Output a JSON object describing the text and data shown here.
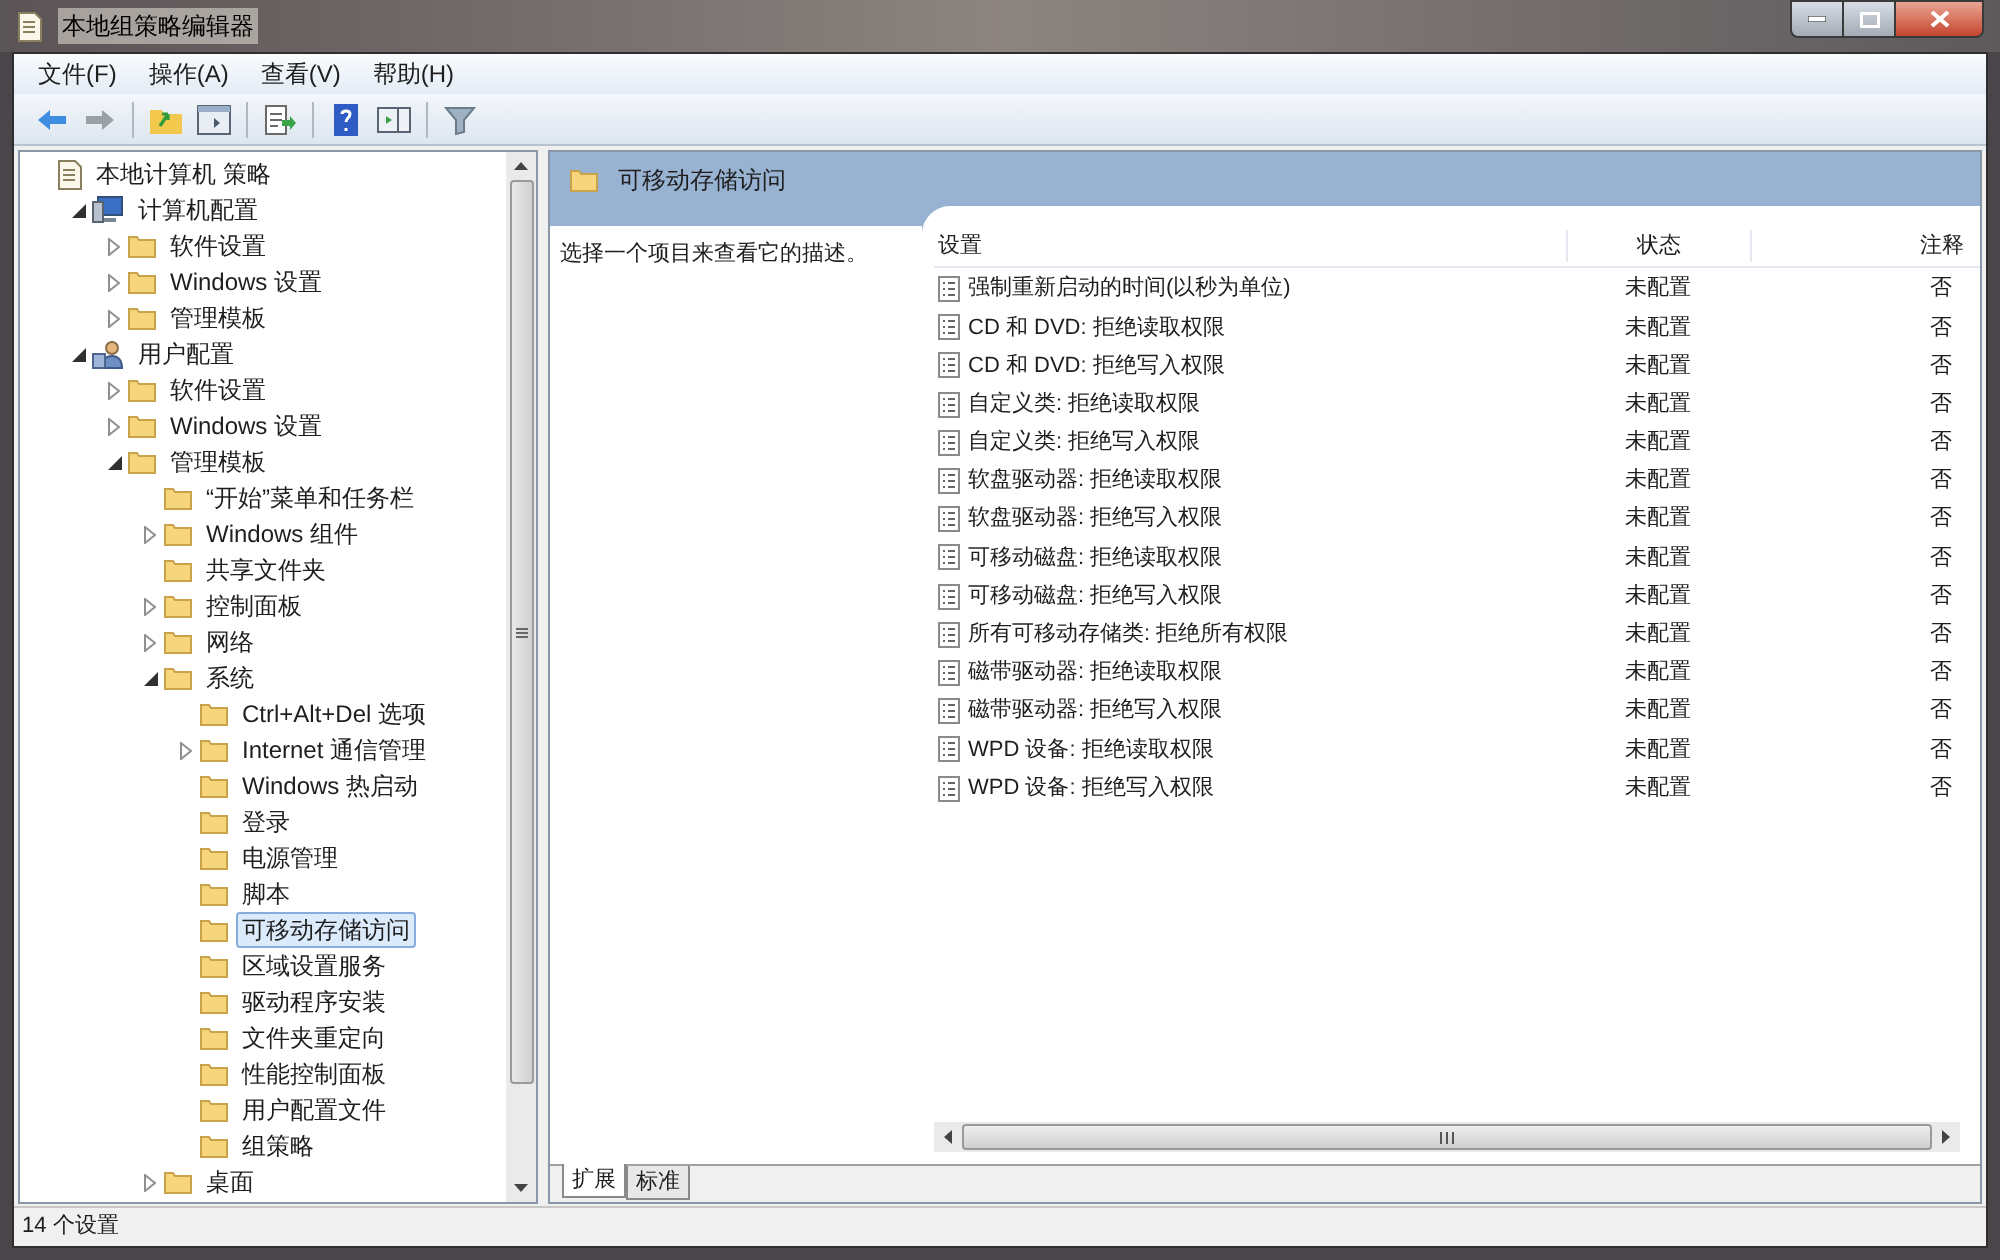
{
  "window": {
    "title": "本地组策略编辑器"
  },
  "menu": [
    "文件(F)",
    "操作(A)",
    "查看(V)",
    "帮助(H)"
  ],
  "tree": [
    {
      "label": "本地计算机 策略",
      "kind": "policy",
      "selected": false,
      "children": [
        {
          "label": "计算机配置",
          "kind": "computer",
          "expanded": true,
          "selected": false,
          "children": [
            {
              "label": "软件设置",
              "kind": "folder",
              "expanded": false,
              "selected": false
            },
            {
              "label": "Windows 设置",
              "kind": "folder",
              "expanded": false,
              "selected": false
            },
            {
              "label": "管理模板",
              "kind": "folder",
              "expanded": false,
              "selected": false
            }
          ]
        },
        {
          "label": "用户配置",
          "kind": "user",
          "expanded": true,
          "selected": false,
          "children": [
            {
              "label": "软件设置",
              "kind": "folder",
              "expanded": false,
              "selected": false
            },
            {
              "label": "Windows 设置",
              "kind": "folder",
              "expanded": false,
              "selected": false
            },
            {
              "label": "管理模板",
              "kind": "folder",
              "expanded": true,
              "selected": false,
              "children": [
                {
                  "label": "“开始”菜单和任务栏",
                  "kind": "folder",
                  "selected": false
                },
                {
                  "label": "Windows 组件",
                  "kind": "folder",
                  "expanded": false,
                  "selected": false
                },
                {
                  "label": "共享文件夹",
                  "kind": "folder",
                  "selected": false
                },
                {
                  "label": "控制面板",
                  "kind": "folder",
                  "expanded": false,
                  "selected": false
                },
                {
                  "label": "网络",
                  "kind": "folder",
                  "expanded": false,
                  "selected": false
                },
                {
                  "label": "系统",
                  "kind": "folder",
                  "expanded": true,
                  "selected": false,
                  "children": [
                    {
                      "label": "Ctrl+Alt+Del 选项",
                      "kind": "folder",
                      "selected": false
                    },
                    {
                      "label": "Internet 通信管理",
                      "kind": "folder",
                      "expanded": false,
                      "selected": false
                    },
                    {
                      "label": "Windows 热启动",
                      "kind": "folder",
                      "selected": false
                    },
                    {
                      "label": "登录",
                      "kind": "folder",
                      "selected": false
                    },
                    {
                      "label": "电源管理",
                      "kind": "folder",
                      "selected": false
                    },
                    {
                      "label": "脚本",
                      "kind": "folder",
                      "selected": false
                    },
                    {
                      "label": "可移动存储访问",
                      "kind": "folder",
                      "selected": true
                    },
                    {
                      "label": "区域设置服务",
                      "kind": "folder",
                      "selected": false
                    },
                    {
                      "label": "驱动程序安装",
                      "kind": "folder",
                      "selected": false
                    },
                    {
                      "label": "文件夹重定向",
                      "kind": "folder",
                      "selected": false
                    },
                    {
                      "label": "性能控制面板",
                      "kind": "folder",
                      "selected": false
                    },
                    {
                      "label": "用户配置文件",
                      "kind": "folder",
                      "selected": false
                    },
                    {
                      "label": "组策略",
                      "kind": "folder",
                      "selected": false
                    }
                  ]
                },
                {
                  "label": "桌面",
                  "kind": "folder",
                  "expanded": false,
                  "selected": false
                }
              ]
            }
          ]
        }
      ]
    }
  ],
  "content": {
    "title": "可移动存储访问",
    "description": "选择一个项目来查看它的描述。",
    "columns": [
      "设置",
      "状态",
      "注释"
    ],
    "rows": [
      {
        "setting": "强制重新启动的时间(以秒为单位)",
        "state": "未配置",
        "comment": "否"
      },
      {
        "setting": "CD 和 DVD: 拒绝读取权限",
        "state": "未配置",
        "comment": "否"
      },
      {
        "setting": "CD 和 DVD: 拒绝写入权限",
        "state": "未配置",
        "comment": "否"
      },
      {
        "setting": "自定义类: 拒绝读取权限",
        "state": "未配置",
        "comment": "否"
      },
      {
        "setting": "自定义类: 拒绝写入权限",
        "state": "未配置",
        "comment": "否"
      },
      {
        "setting": "软盘驱动器: 拒绝读取权限",
        "state": "未配置",
        "comment": "否"
      },
      {
        "setting": "软盘驱动器: 拒绝写入权限",
        "state": "未配置",
        "comment": "否"
      },
      {
        "setting": "可移动磁盘: 拒绝读取权限",
        "state": "未配置",
        "comment": "否"
      },
      {
        "setting": "可移动磁盘: 拒绝写入权限",
        "state": "未配置",
        "comment": "否"
      },
      {
        "setting": "所有可移动存储类: 拒绝所有权限",
        "state": "未配置",
        "comment": "否"
      },
      {
        "setting": "磁带驱动器: 拒绝读取权限",
        "state": "未配置",
        "comment": "否"
      },
      {
        "setting": "磁带驱动器: 拒绝写入权限",
        "state": "未配置",
        "comment": "否"
      },
      {
        "setting": "WPD 设备: 拒绝读取权限",
        "state": "未配置",
        "comment": "否"
      },
      {
        "setting": "WPD 设备: 拒绝写入权限",
        "state": "未配置",
        "comment": "否"
      }
    ],
    "tabs": [
      {
        "label": "扩展",
        "selected": true
      },
      {
        "label": "标准",
        "selected": false
      }
    ]
  },
  "status_bar": "14 个设置"
}
